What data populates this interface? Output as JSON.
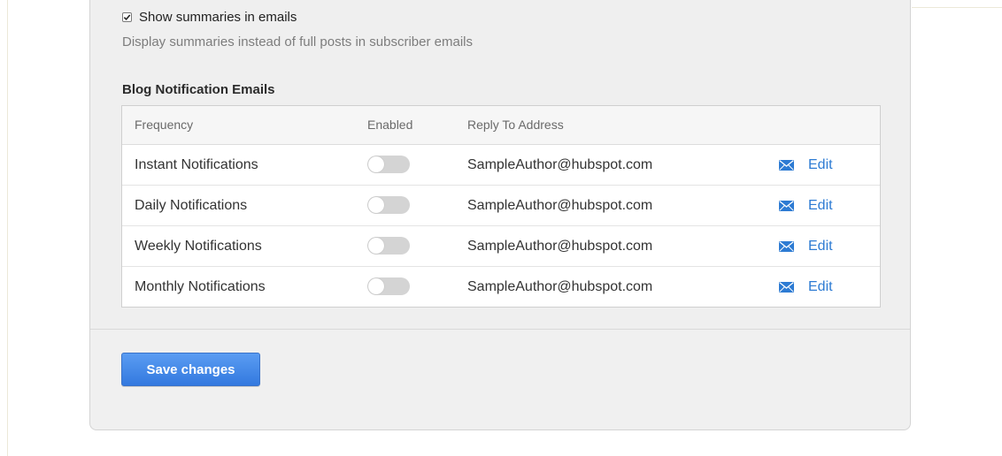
{
  "summaries": {
    "checkbox_label": "Show summaries in emails",
    "checked": true,
    "help_text": "Display summaries instead of full posts in subscriber emails"
  },
  "notifications": {
    "title": "Blog Notification Emails",
    "columns": {
      "frequency": "Frequency",
      "enabled": "Enabled",
      "reply_to": "Reply To Address"
    },
    "rows": [
      {
        "frequency": "Instant Notifications",
        "enabled": false,
        "reply_to": "SampleAuthor@hubspot.com",
        "action": "Edit"
      },
      {
        "frequency": "Daily Notifications",
        "enabled": false,
        "reply_to": "SampleAuthor@hubspot.com",
        "action": "Edit"
      },
      {
        "frequency": "Weekly Notifications",
        "enabled": false,
        "reply_to": "SampleAuthor@hubspot.com",
        "action": "Edit"
      },
      {
        "frequency": "Monthly Notifications",
        "enabled": false,
        "reply_to": "SampleAuthor@hubspot.com",
        "action": "Edit"
      }
    ],
    "edit_icon": "envelope-icon"
  },
  "footer": {
    "save_label": "Save changes"
  },
  "colors": {
    "accent": "#2d7bd3",
    "button": "#3f83e6",
    "toggle_off": "#d4d4d4"
  }
}
